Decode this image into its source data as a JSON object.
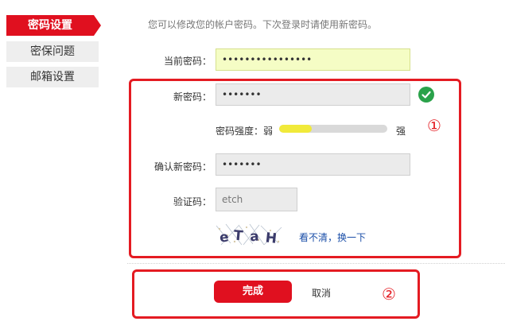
{
  "sidebar": {
    "items": [
      {
        "label": "密码设置"
      },
      {
        "label": "密保问题"
      },
      {
        "label": "邮箱设置"
      }
    ]
  },
  "intro": "您可以修改您的帐户密码。下次登录时请使用新密码。",
  "form": {
    "current_password": {
      "label": "当前密码：",
      "value": "••••••••••••••••"
    },
    "new_password": {
      "label": "新密码：",
      "value": "•••••••"
    },
    "strength": {
      "label": "密码强度：",
      "weak": "弱",
      "strong": "强",
      "level_percent": 30
    },
    "confirm_password": {
      "label": "确认新密码：",
      "value": "•••••••"
    },
    "captcha": {
      "label": "验证码：",
      "value": "etch",
      "image_text": "eTaH",
      "refresh_link": "看不清，换一下"
    }
  },
  "buttons": {
    "done": "完成",
    "cancel": "取消"
  },
  "annotations": {
    "one": "①",
    "two": "②"
  },
  "colors": {
    "accent": "#e0101f",
    "annotation": "#e41b22",
    "ok": "#2aa24a",
    "strength": "#f1ea3a"
  },
  "icons": {
    "valid": "check-circle-icon"
  }
}
